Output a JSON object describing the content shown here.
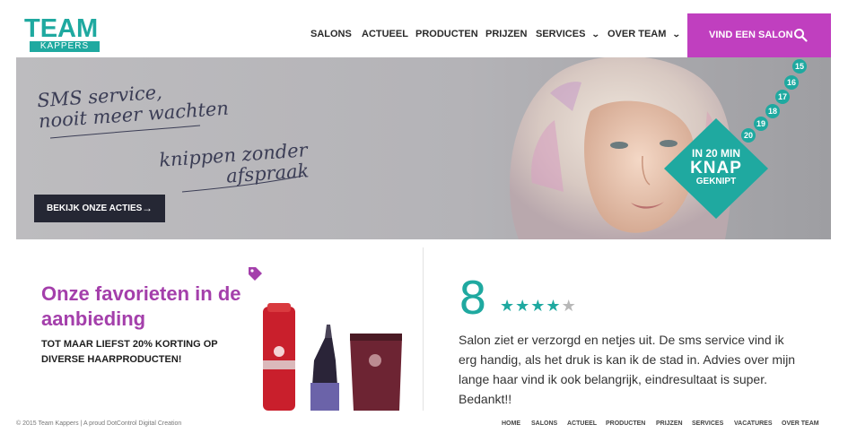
{
  "header": {
    "logo_top": "TEAM",
    "logo_bottom": "KAPPERS",
    "nav": [
      {
        "label": "SALONS",
        "dropdown": false
      },
      {
        "label": "ACTUEEL",
        "dropdown": false
      },
      {
        "label": "PRODUCTEN",
        "dropdown": false
      },
      {
        "label": "PRIJZEN",
        "dropdown": false
      },
      {
        "label": "SERVICES",
        "dropdown": true
      },
      {
        "label": "OVER TEAM",
        "dropdown": true
      }
    ],
    "find_salon": "VIND EEN SALON",
    "chevron": "⌄"
  },
  "hero": {
    "script_line1": "SMS service,",
    "script_line2": "nooit meer wachten",
    "script_line3": "knippen zonder",
    "script_line4": "afspraak",
    "cta": "BEKIJK ONZE ACTIES",
    "cta_arrow": "→",
    "badge_line1": "IN 20 MIN",
    "badge_line2": "KNAP",
    "badge_line3": "GEKNIPT",
    "minute_numbers": [
      "15",
      "16",
      "17",
      "18",
      "19",
      "20"
    ]
  },
  "promo": {
    "title": "Onze favorieten in de aanbieding",
    "subtitle": "TOT MAAR LIEFST 20% KORTING OP DIVERSE HAARPRODUCTEN!"
  },
  "review": {
    "score": "8",
    "stars_filled": 4,
    "stars_total": 5,
    "text": "Salon ziet er verzorgd en netjes uit. De sms service vind ik erg handig, als het druk is kan ik de stad in. Advies over mijn lange haar vind ik ook belangrijk, eindresultaat is super. Bedankt!!"
  },
  "footer": {
    "copyright": "© 2015 Team Kappers | A proud DotControl Digital Creation",
    "nav": [
      "HOME",
      "SALONS",
      "ACTUEEL",
      "PRODUCTEN",
      "PRIJZEN",
      "SERVICES",
      "VACATURES",
      "OVER TEAM"
    ]
  },
  "colors": {
    "brand_teal": "#1fa9a0",
    "brand_purple": "#c03fbf",
    "promo_purple": "#a43fab",
    "dark_button": "#252734"
  }
}
